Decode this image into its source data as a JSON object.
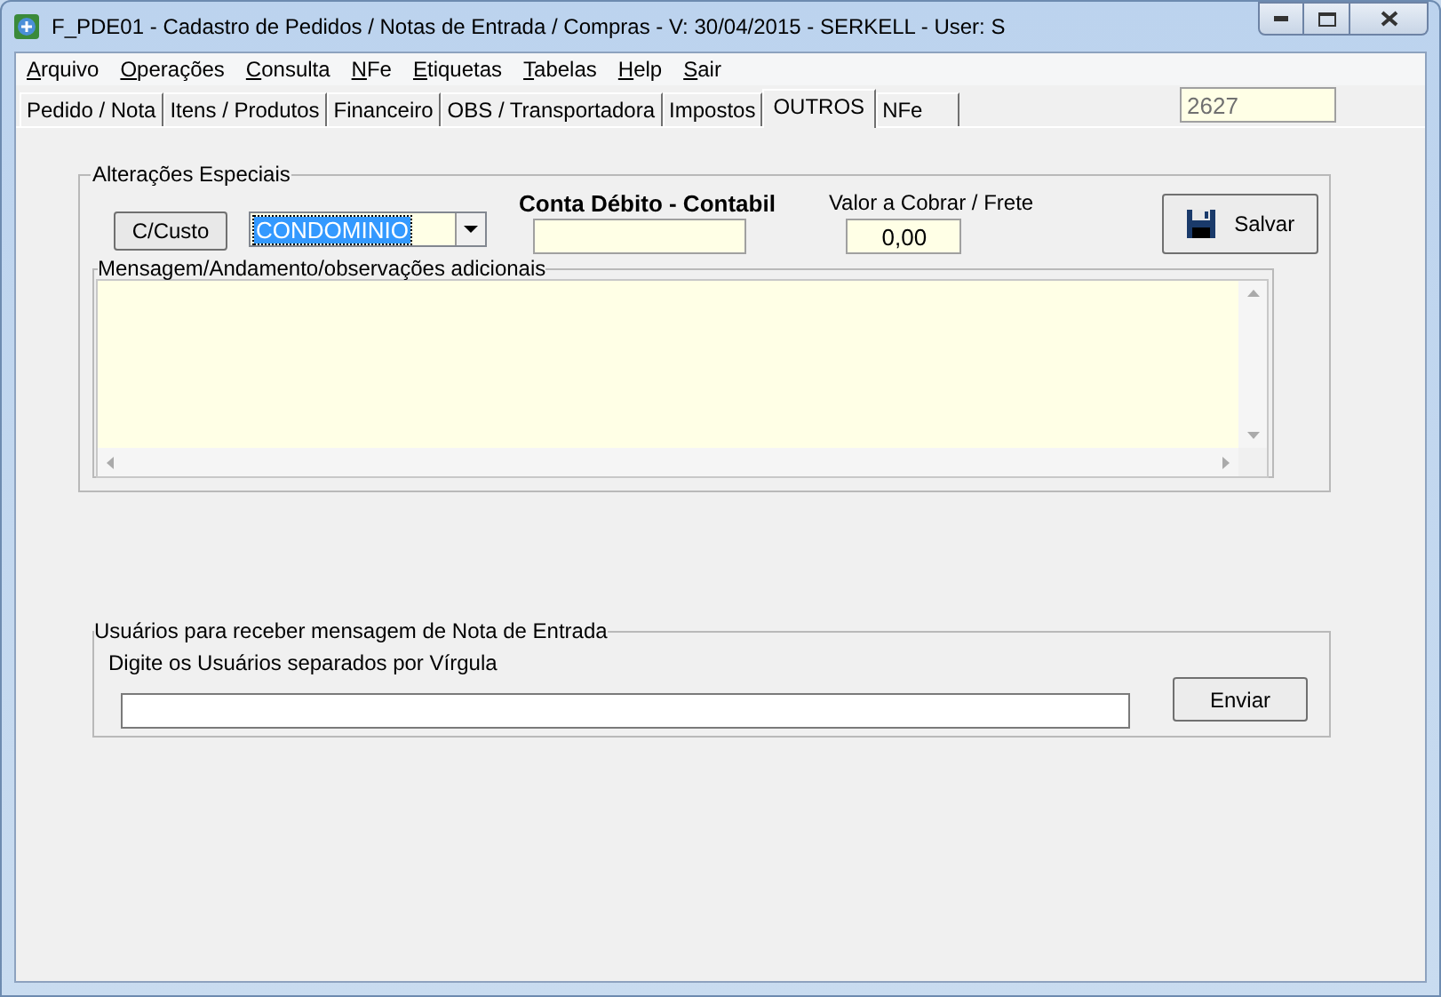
{
  "window": {
    "title": "F_PDE01 - Cadastro de Pedidos / Notas de Entrada / Compras - V: 30/04/2015 - SERKELL - User: S"
  },
  "menu": [
    {
      "label": "Arquivo"
    },
    {
      "label": "Operações"
    },
    {
      "label": "Consulta"
    },
    {
      "label": "NFe"
    },
    {
      "label": "Etiquetas"
    },
    {
      "label": "Tabelas"
    },
    {
      "label": "Help"
    },
    {
      "label": "Sair"
    }
  ],
  "tabs": [
    {
      "label": "Pedido / Nota",
      "selected": false
    },
    {
      "label": "Itens / Produtos",
      "selected": false
    },
    {
      "label": "Financeiro",
      "selected": false
    },
    {
      "label": "OBS / Transportadora",
      "selected": false
    },
    {
      "label": "Impostos",
      "selected": false
    },
    {
      "label": "OUTROS",
      "selected": true
    },
    {
      "label": "NFe",
      "selected": false
    }
  ],
  "record_field": {
    "value": "2627"
  },
  "special_changes": {
    "title": "Alterações Especiais",
    "cost_center_button": "C/Custo",
    "cost_center_combo": {
      "value": "CONDOMINIO",
      "selected": true
    },
    "debit_account": {
      "label": "Conta Débito - Contabil"
    },
    "freight": {
      "label": "Valor a Cobrar / Frete",
      "value": "0,00"
    },
    "save_button": "Salvar",
    "messages": {
      "title": "Mensagem/Andamento/observações adicionais"
    }
  },
  "notify_users": {
    "title": "Usuários para receber mensagem de Nota de Entrada",
    "hint": "Digite os Usuários separados por Vírgula",
    "send_button": "Enviar"
  }
}
